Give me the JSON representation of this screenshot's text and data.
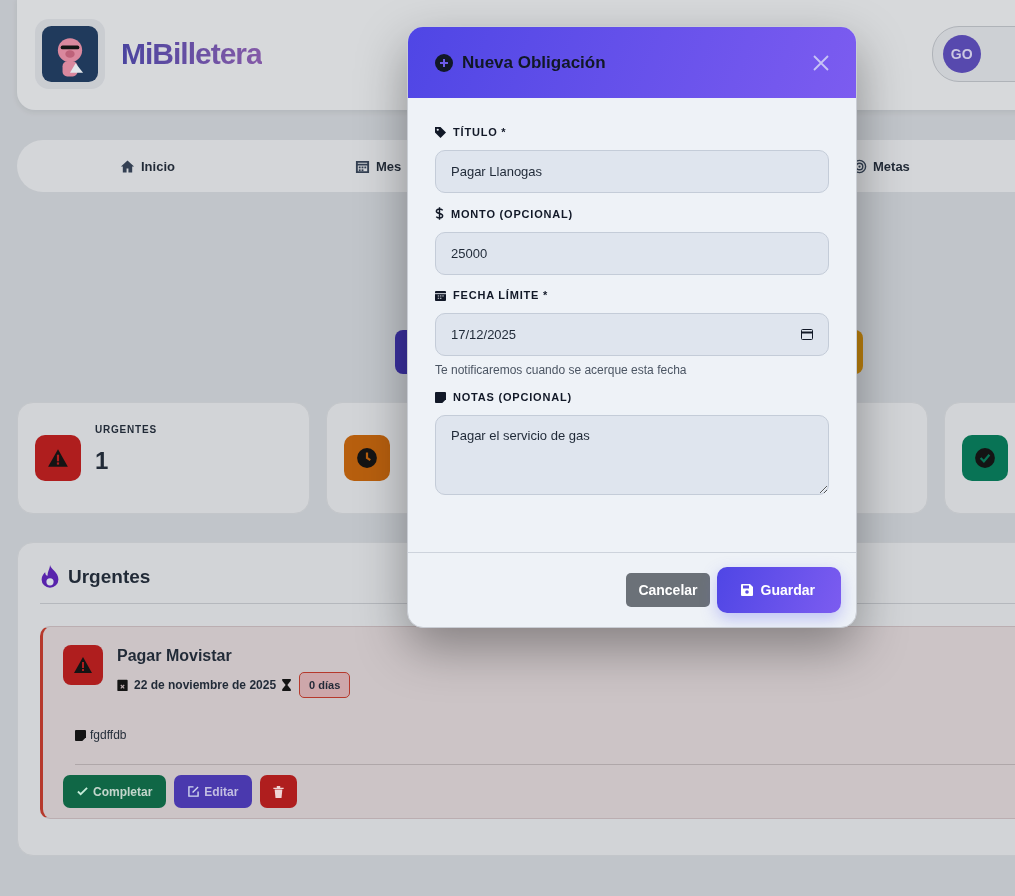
{
  "header": {
    "app_name": "MiBilletera",
    "user_initials": "GO"
  },
  "nav": [
    {
      "label": "Inicio",
      "kind": "home"
    },
    {
      "label": "Mes",
      "kind": "calendar"
    },
    {
      "label": "Metas",
      "kind": "target"
    }
  ],
  "stats": [
    {
      "kind": "urgent",
      "label": "URGENTES",
      "value": "1"
    },
    {
      "kind": "pending"
    },
    {
      "kind": "blank"
    },
    {
      "kind": "done"
    }
  ],
  "urgent_section": {
    "title": "Urgentes",
    "items": [
      {
        "title": "Pagar Movistar",
        "date": "22 de noviembre de 2025",
        "days": "0 días",
        "note": "fgdffdb",
        "complete": "Completar",
        "edit": "Editar"
      }
    ]
  },
  "modal": {
    "title": "Nueva Obligación",
    "fields": [
      {
        "kind": "text",
        "label": "TÍTULO *",
        "value": "Pagar Llanogas"
      },
      {
        "kind": "text",
        "label": "MONTO (OPCIONAL)",
        "value": "25000"
      },
      {
        "kind": "date",
        "label": "FECHA LÍMITE *",
        "value": "17/12/2025",
        "help": "Te notificaremos cuando se acerque esta fecha"
      },
      {
        "kind": "textarea",
        "label": "NOTAS (OPCIONAL)",
        "value": "Pagar el servicio de gas"
      }
    ],
    "cancel": "Cancelar",
    "save": "Guardar"
  }
}
